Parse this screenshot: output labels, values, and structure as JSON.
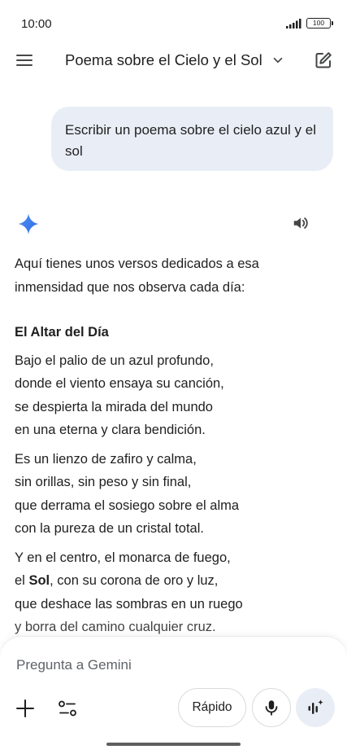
{
  "status_bar": {
    "time": "10:00",
    "battery": "100"
  },
  "header": {
    "title": "Poema sobre el Cielo y el Sol"
  },
  "user_message": {
    "text": "Escribir un poema sobre el cielo azul y el sol"
  },
  "response": {
    "intro_lines": [
      "Aquí tienes unos versos dedicados a esa",
      "inmensidad que nos observa cada día:"
    ],
    "poem_title": "El Altar del Día",
    "stanza1": [
      "Bajo el palio de un azul profundo,",
      "donde el viento ensaya su canción,",
      "se despierta la mirada del mundo",
      "en una eterna y clara bendición."
    ],
    "stanza2": [
      "Es un lienzo de zafiro y calma,",
      "sin orillas, sin peso y sin final,",
      "que derrama el sosiego sobre el alma",
      "con la pureza de un cristal total."
    ],
    "stanza3": {
      "line1": "Y en el centro, el monarca de fuego,",
      "line2_pre": "el ",
      "line2_bold": "Sol",
      "line2_post": ", con su corona de oro y luz,",
      "line3": "que deshace las sombras en un ruego",
      "line4": "y borra del camino cualquier cruz."
    }
  },
  "input": {
    "placeholder": "Pregunta a Gemini",
    "mode_label": "Rápido"
  },
  "colors": {
    "accent_blue": "#1a73e8",
    "bubble_bg": "#e9eef6"
  }
}
